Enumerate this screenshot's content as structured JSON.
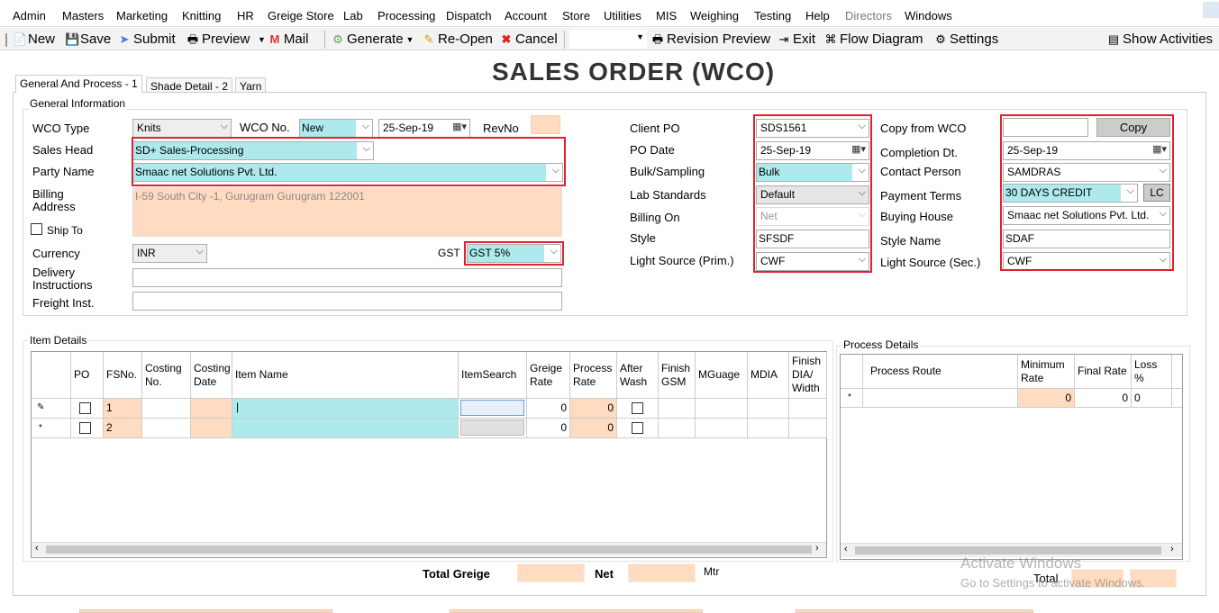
{
  "menu": [
    "Admin",
    "Masters",
    "Marketing",
    "Knitting",
    "HR",
    "Greige Store",
    "Lab",
    "Processing",
    "Dispatch",
    "Account",
    "Store",
    "Utilities",
    "MIS",
    "Weighing",
    "Testing",
    "Help",
    "Directors",
    "Windows"
  ],
  "toolbar": {
    "new": "New",
    "save": "Save",
    "submit": "Submit",
    "preview": "Preview",
    "mail": "Mail",
    "generate": "Generate",
    "reopen": "Re-Open",
    "cancel": "Cancel",
    "revision_preview": "Revision Preview",
    "exit": "Exit",
    "flow_diagram": "Flow Diagram",
    "settings": "Settings",
    "show_activities": "Show Activities"
  },
  "title": "SALES ORDER (WCO)",
  "tabs": [
    "General And Process - 1",
    "Shade Detail - 2",
    "Yarn"
  ],
  "general": {
    "group_title": "General Information",
    "wco_type_label": "WCO Type",
    "wco_type": "Knits",
    "wco_no_label": "WCO No.",
    "wco_no": "New",
    "date": "25-Sep-19",
    "revno_label": "RevNo",
    "sales_head_label": "Sales Head",
    "sales_head": "SD+ Sales-Processing",
    "party_name_label": "Party Name",
    "party_name": "Smaac net Solutions Pvt. Ltd.",
    "billing_address_label_1": "Billing",
    "billing_address_label_2": "Address",
    "billing_address": "I-59 South City -1, Gurugram Gurugram 122001",
    "ship_to_label": "Ship To",
    "currency_label": "Currency",
    "currency": "INR",
    "gst_label": "GST",
    "gst": "GST 5%",
    "delivery_label_1": "Delivery",
    "delivery_label_2": "Instructions",
    "freight_label": "Freight Inst.",
    "client_po_label": "Client PO",
    "client_po": "SDS1561",
    "po_date_label": "PO Date",
    "po_date": "25-Sep-19",
    "bulk_label": "Bulk/Sampling",
    "bulk": "Bulk",
    "lab_label": "Lab Standards",
    "lab": "Default",
    "billing_on_label": "Billing On",
    "billing_on": "Net",
    "style_label": "Style",
    "style": "SFSDF",
    "light_prim_label": "Light Source (Prim.)",
    "light_prim": "CWF",
    "copy_wco_label": "Copy from WCO",
    "copy_button": "Copy",
    "completion_label": "Completion Dt.",
    "completion": "25-Sep-19",
    "contact_label": "Contact Person",
    "contact": "SAMDRAS",
    "payment_label": "Payment Terms",
    "payment": "30 DAYS CREDIT",
    "lc_button": "LC",
    "buying_label": "Buying House",
    "buying": "Smaac net Solutions Pvt. Ltd.",
    "style_name_label": "Style Name",
    "style_name": "SDAF",
    "light_sec_label": "Light Source (Sec.)",
    "light_sec": "CWF"
  },
  "items": {
    "group_title": "Item Details",
    "headers": [
      "PO",
      "FSNo.",
      "Costing No.",
      "Costing Date",
      "Item Name",
      "ItemSearch",
      "Greige Rate",
      "Process Rate",
      "After Wash",
      "Finish GSM",
      "MGuage",
      "MDIA",
      "Finish DIA/ Width"
    ],
    "rows": [
      {
        "marker": "✎",
        "fsno": "1",
        "greige": "0",
        "process": "0"
      },
      {
        "marker": "*",
        "fsno": "2",
        "greige": "0",
        "process": "0"
      }
    ],
    "total_greige_label": "Total Greige",
    "net_label": "Net",
    "unit": "Mtr"
  },
  "process": {
    "group_title": "Process Details",
    "headers": [
      "Process Route",
      "Minimum Rate",
      "Final Rate",
      "Loss %"
    ],
    "row": {
      "marker": "*",
      "min": "0",
      "final": "0",
      "loss": "0"
    },
    "total_label": "Total"
  },
  "watermark": {
    "line1": "Activate Windows",
    "line2": "Go to Settings to activate Windows."
  }
}
